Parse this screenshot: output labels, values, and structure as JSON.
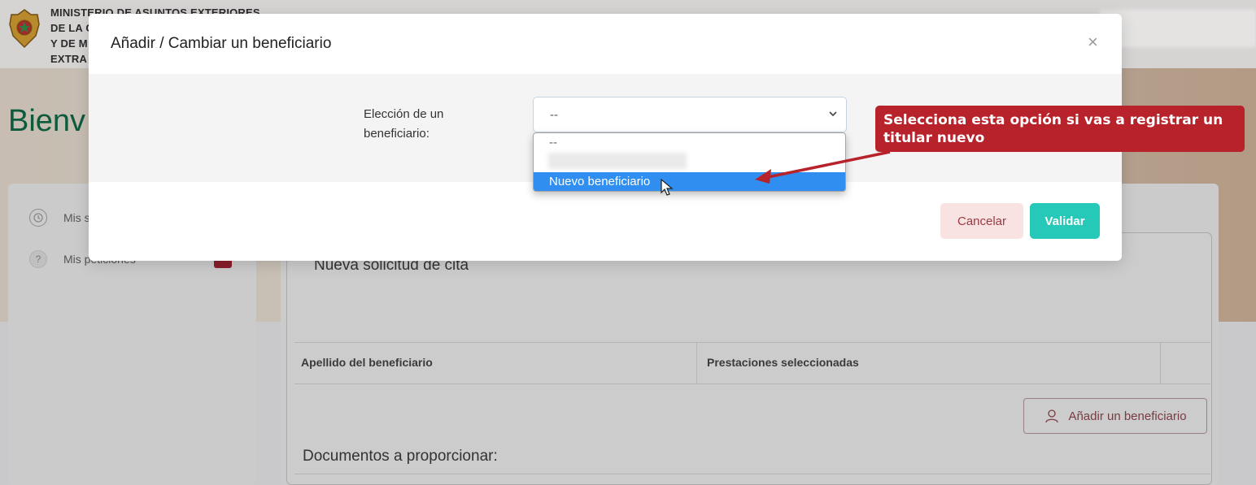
{
  "header": {
    "ministry_lines": [
      "MINISTERIO DE ASUNTOS EXTERIORES",
      "DE LA C",
      "Y DE M",
      "EXTRA"
    ]
  },
  "page": {
    "greeting_partial": "Bienv"
  },
  "sidebar": {
    "items": [
      {
        "label": "Mis s",
        "icon": "clock-icon"
      },
      {
        "label": "Mis peticiones",
        "icon": "question-icon"
      }
    ]
  },
  "main": {
    "title": "Nueva solicitud de cita",
    "table_headers": [
      "Apellido del beneficiario",
      "Prestaciones seleccionadas"
    ],
    "add_button": "Añadir un beneficiario",
    "documents_title": "Documentos a proporcionar:"
  },
  "modal": {
    "title": "Añadir / Cambiar un beneficiario",
    "close": "×",
    "field_label": "Elección de un beneficiario:",
    "selected_value": "--",
    "options": [
      "--",
      "",
      "Nuevo beneficiario"
    ],
    "cancel": "Cancelar",
    "validate": "Validar"
  },
  "annotation": {
    "text": "Selecciona esta opción si vas a registrar un titular nuevo"
  },
  "colors": {
    "accent_teal": "#26c9b8",
    "option_highlight": "#2f8ef0",
    "annotation_red": "#b8222a"
  }
}
